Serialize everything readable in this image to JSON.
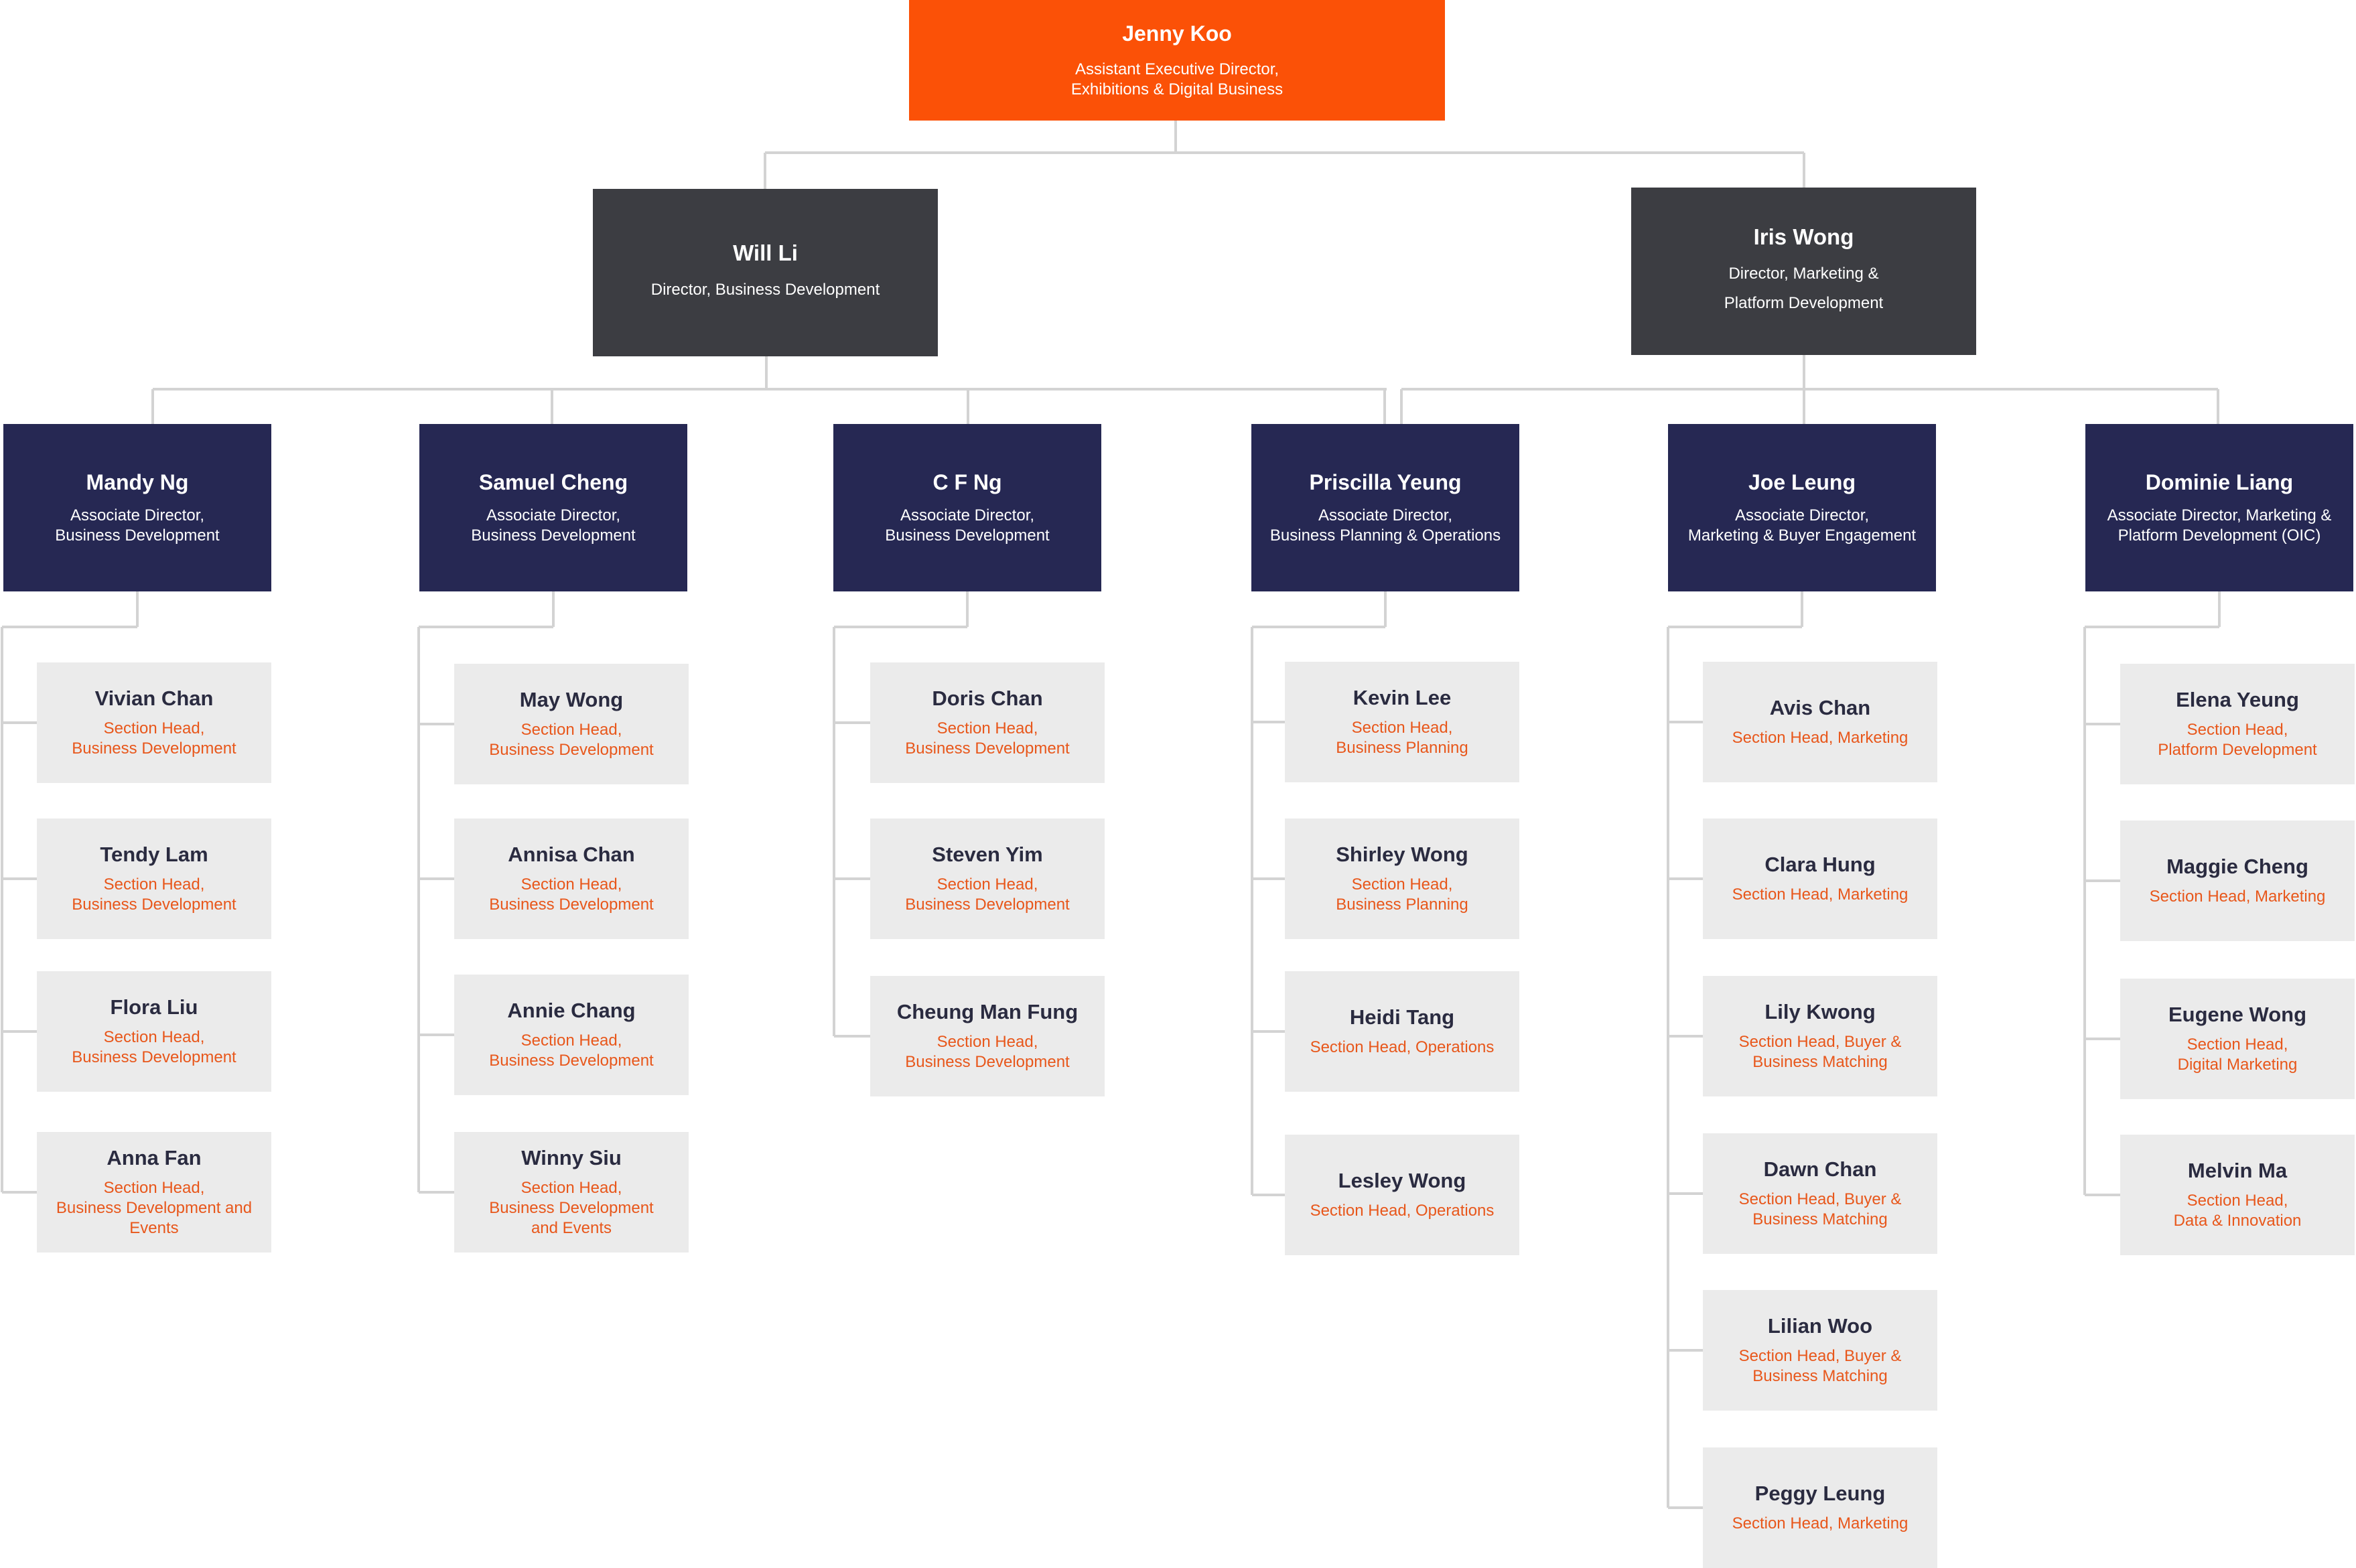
{
  "colors": {
    "executive": "#fb5107",
    "director": "#3c3d42",
    "associate": "#262853",
    "section": "#ebebeb",
    "section_title": "#e8571b",
    "connector": "#d3d3d3"
  },
  "executive": {
    "name": "Jenny Koo",
    "title": "Assistant Executive Director,\nExhibitions & Digital Business"
  },
  "directors": [
    {
      "name": "Will Li",
      "title": "Director, Business Development"
    },
    {
      "name": "Iris Wong",
      "title": "Director, Marketing &\nPlatform Development"
    }
  ],
  "associates": [
    {
      "name": "Mandy Ng",
      "title": "Associate Director,\nBusiness Development",
      "reports_to": "Will Li",
      "sections": [
        {
          "name": "Vivian Chan",
          "title": "Section Head,\nBusiness Development"
        },
        {
          "name": "Tendy Lam",
          "title": "Section Head,\nBusiness Development"
        },
        {
          "name": "Flora Liu",
          "title": "Section Head,\nBusiness Development"
        },
        {
          "name": "Anna Fan",
          "title": "Section Head,\nBusiness Development and\nEvents"
        }
      ]
    },
    {
      "name": "Samuel Cheng",
      "title": "Associate Director,\nBusiness Development",
      "reports_to": "Will Li",
      "sections": [
        {
          "name": "May Wong",
          "title": "Section Head,\nBusiness Development"
        },
        {
          "name": "Annisa Chan",
          "title": "Section Head,\nBusiness Development"
        },
        {
          "name": "Annie Chang",
          "title": "Section Head,\nBusiness Development"
        },
        {
          "name": "Winny Siu",
          "title": "Section Head,\nBusiness Development\nand Events"
        }
      ]
    },
    {
      "name": "C F Ng",
      "title": "Associate Director,\nBusiness Development",
      "reports_to": "Will Li",
      "sections": [
        {
          "name": "Doris Chan",
          "title": "Section Head,\nBusiness Development"
        },
        {
          "name": "Steven Yim",
          "title": "Section Head,\nBusiness Development"
        },
        {
          "name": "Cheung Man Fung",
          "title": "Section Head,\nBusiness Development"
        }
      ]
    },
    {
      "name": "Priscilla Yeung",
      "title": "Associate Director,\nBusiness Planning & Operations",
      "reports_to": "Will Li",
      "sections": [
        {
          "name": "Kevin Lee",
          "title": "Section Head,\nBusiness Planning"
        },
        {
          "name": "Shirley Wong",
          "title": "Section Head,\nBusiness Planning"
        },
        {
          "name": "Heidi Tang",
          "title": "Section Head, Operations"
        },
        {
          "name": "Lesley Wong",
          "title": "Section Head, Operations"
        }
      ]
    },
    {
      "name": "Joe Leung",
      "title": "Associate Director,\nMarketing & Buyer Engagement",
      "reports_to": "Iris Wong",
      "sections": [
        {
          "name": "Avis Chan",
          "title": "Section Head, Marketing"
        },
        {
          "name": "Clara Hung",
          "title": "Section Head, Marketing"
        },
        {
          "name": "Lily Kwong",
          "title": "Section Head, Buyer &\nBusiness Matching"
        },
        {
          "name": "Dawn Chan",
          "title": "Section Head, Buyer &\nBusiness Matching"
        },
        {
          "name": "Lilian Woo",
          "title": "Section Head, Buyer &\nBusiness Matching"
        },
        {
          "name": "Peggy Leung",
          "title": "Section Head, Marketing"
        }
      ]
    },
    {
      "name": "Dominie Liang",
      "title": "Associate Director, Marketing &\nPlatform Development (OIC)",
      "reports_to": "Iris Wong",
      "sections": [
        {
          "name": "Elena Yeung",
          "title": "Section Head,\nPlatform Development"
        },
        {
          "name": "Maggie Cheng",
          "title": "Section Head, Marketing"
        },
        {
          "name": "Eugene Wong",
          "title": "Section Head,\nDigital Marketing"
        },
        {
          "name": "Melvin Ma",
          "title": "Section Head,\nData & Innovation"
        }
      ]
    }
  ]
}
